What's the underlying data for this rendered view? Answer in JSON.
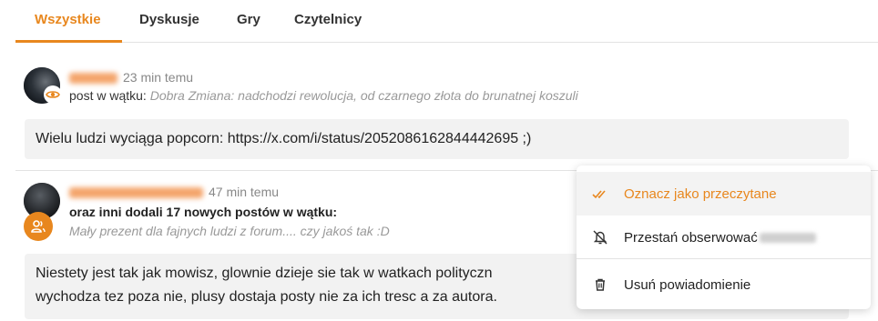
{
  "tabs": [
    {
      "label": "Wszystkie",
      "active": true
    },
    {
      "label": "Dyskusje",
      "active": false
    },
    {
      "label": "Gry",
      "active": false
    },
    {
      "label": "Czytelnicy",
      "active": false
    }
  ],
  "notifications": [
    {
      "time": "23 min temu",
      "prefix": "post w wątku: ",
      "thread": "Dobra Zmiana: nadchodzi rewolucja, od czarnego złota do brunatnej koszuli",
      "quote": "Wielu ludzi wyciąga popcorn: https://x.com/i/status/2052086162844442695 ;)",
      "badge_icon": "eye-icon"
    },
    {
      "time": "47 min temu",
      "summary": "oraz inni dodali 17 nowych postów w wątku:",
      "thread": "Mały prezent dla fajnych ludzi z forum.... czy jakoś tak :D",
      "quote_line1": "Niestety jest tak jak mowisz, glownie dzieje sie tak w watkach polityczn",
      "quote_line2": "wychodza tez poza nie, plusy dostaja posty nie za ich tresc a za autora.",
      "badge_icon": "group-icon"
    }
  ],
  "context_menu": {
    "mark_read": "Oznacz jako przeczytane",
    "unfollow": "Przestań obserwować",
    "delete": "Usuń powiadomienie"
  },
  "colors": {
    "accent": "#e8871e",
    "muted": "#999999",
    "quote_bg": "#f2f2f2"
  }
}
